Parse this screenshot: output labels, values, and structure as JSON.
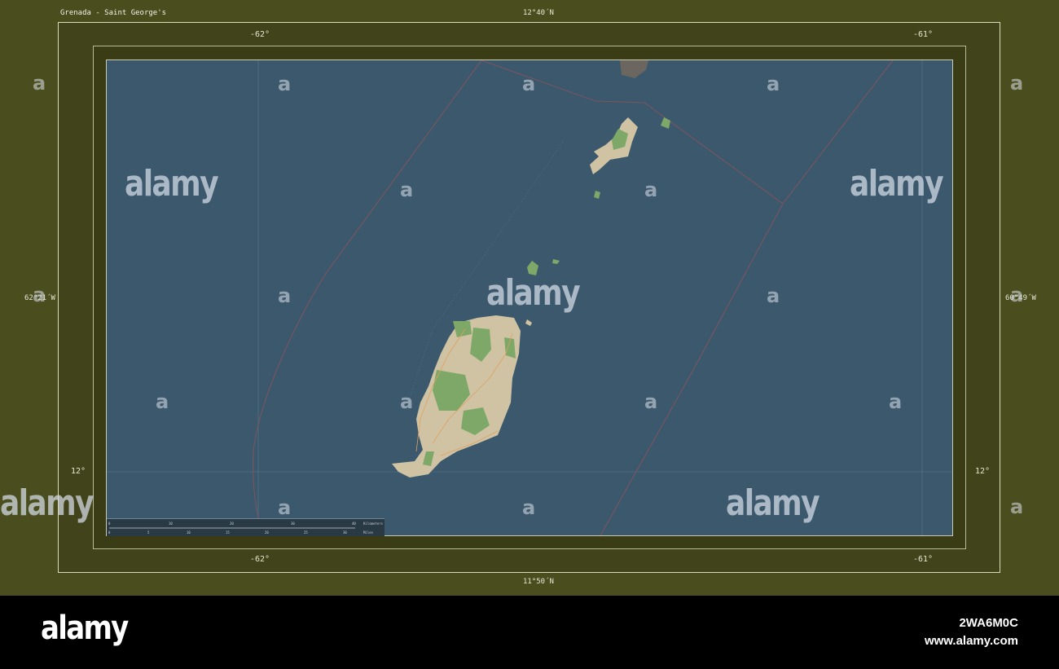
{
  "title": "Grenada - Saint George's",
  "coords": {
    "top_center": "12°40´N",
    "bottom_center": "11°50´N",
    "left_center": "62°21´W",
    "right_center": "60°49´W",
    "lon_left": "-62°",
    "lon_right": "-61°",
    "lat_left": "12°",
    "lat_right": "12°"
  },
  "scale": {
    "km_ticks": [
      "0",
      "10",
      "20",
      "30",
      "40"
    ],
    "km_unit": "Kilometers",
    "mi_ticks": [
      "0",
      "5",
      "10",
      "15",
      "20",
      "25",
      "30"
    ],
    "mi_unit": "Miles"
  },
  "watermark": {
    "logo": "alamy",
    "letter": "a"
  },
  "footer": {
    "logo": "alamy",
    "image_id": "2WA6M0C",
    "url": "www.alamy.com"
  },
  "colors": {
    "sea": "#3b586c",
    "land": "#cfc3a3",
    "forest": "#7ea868",
    "frame": "#4a4e1f"
  }
}
